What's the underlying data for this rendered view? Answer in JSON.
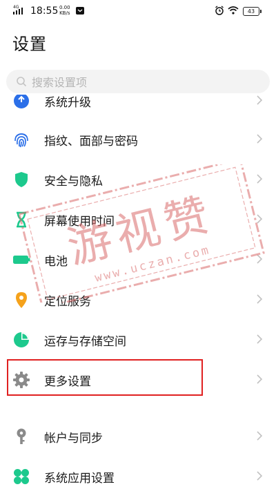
{
  "status_bar": {
    "network": "4G",
    "time": "18:55",
    "net_speed_value": "0.00",
    "net_speed_unit": "KB/s",
    "battery": "43"
  },
  "page": {
    "title": "设置"
  },
  "search": {
    "placeholder": "搜索设置项"
  },
  "items": [
    {
      "label": "系统升级",
      "icon": "system-update-icon",
      "color": "#2b6fe8"
    },
    {
      "label": "指纹、面部与密码",
      "icon": "fingerprint-icon",
      "color": "#2b6fe8"
    },
    {
      "label": "安全与隐私",
      "icon": "shield-icon",
      "color": "#1dc98d"
    },
    {
      "label": "屏幕使用时间",
      "icon": "hourglass-icon",
      "color": "#1dc98d"
    },
    {
      "label": "电池",
      "icon": "battery-icon",
      "color": "#1dc98d"
    },
    {
      "label": "定位服务",
      "icon": "location-pin-icon",
      "color": "#f5a21b"
    },
    {
      "label": "运存与存储空间",
      "icon": "storage-pie-icon",
      "color": "#1dc98d"
    },
    {
      "label": "更多设置",
      "icon": "gear-icon",
      "color": "#8a8a8a"
    },
    {
      "label": "帐户与同步",
      "icon": "key-icon",
      "color": "#8a8a8a"
    },
    {
      "label": "系统应用设置",
      "icon": "apps-grid-icon",
      "color": "#1dc98d"
    }
  ],
  "watermark": {
    "text": "游视赞",
    "url": "www.uczan.com"
  },
  "highlight_color": "#e02020"
}
